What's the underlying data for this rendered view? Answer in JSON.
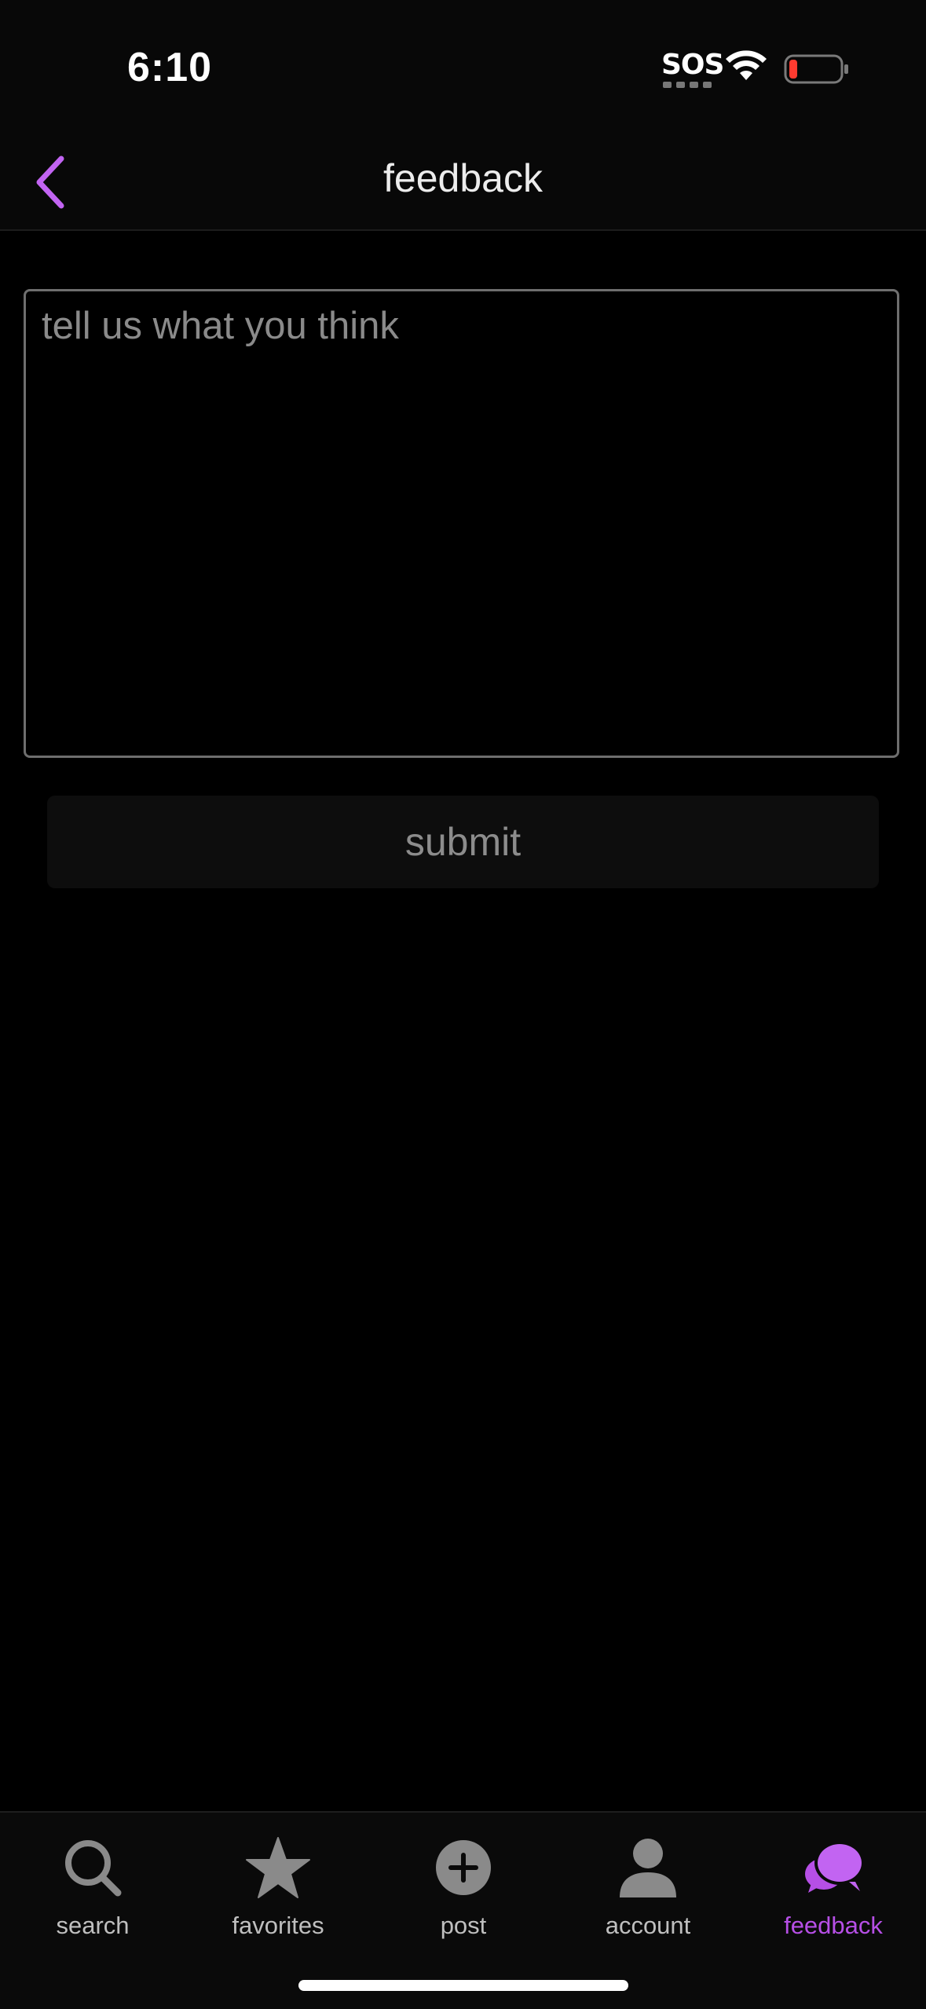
{
  "status_bar": {
    "time": "6:10",
    "sos": "SOS",
    "battery_color": "#ff3b30"
  },
  "header": {
    "title": "feedback",
    "back_icon": "chevron-left-icon",
    "accent_color": "#c264f2"
  },
  "form": {
    "feedback_placeholder": "tell us what you think",
    "feedback_value": "",
    "submit_label": "submit"
  },
  "tabs": [
    {
      "label": "search",
      "icon": "search-icon",
      "active": false
    },
    {
      "label": "favorites",
      "icon": "star-icon",
      "active": false
    },
    {
      "label": "post",
      "icon": "plus-circle-icon",
      "active": false
    },
    {
      "label": "account",
      "icon": "person-icon",
      "active": false
    },
    {
      "label": "feedback",
      "icon": "chat-bubbles-icon",
      "active": true
    }
  ],
  "colors": {
    "active_tab": "#b64fe6",
    "inactive_tab_icon": "#8a8a8a",
    "background": "#000000"
  }
}
